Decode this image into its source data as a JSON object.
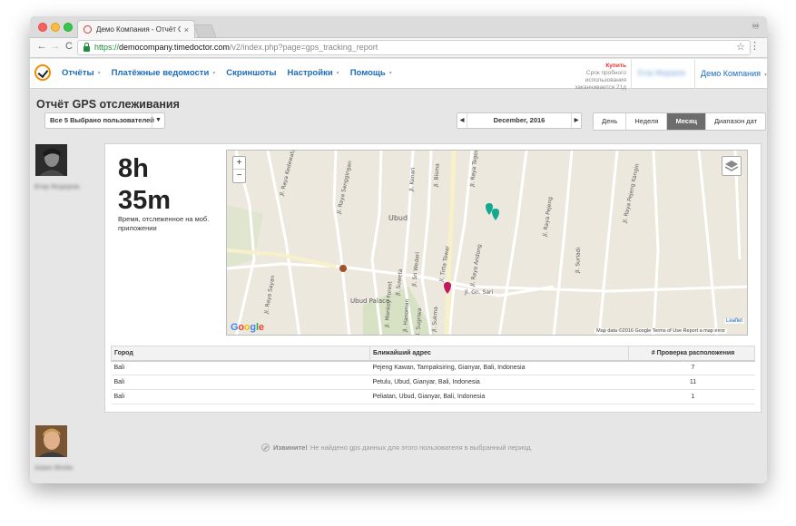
{
  "browser": {
    "tab_title": "Демо Компания - Отчёт GPS",
    "tab_close": "×",
    "url_scheme": "https://",
    "url_host": "democompany.timedoctor.com",
    "url_path": "/v2/index.php?page=gps_tracking_report",
    "back": "←",
    "forward": "→",
    "reload": "C",
    "star": "☆",
    "menu": "⋮",
    "incognito": "♾"
  },
  "header": {
    "menu": [
      {
        "label": "Отчёты"
      },
      {
        "label": "Платёжные ведомости"
      },
      {
        "label": "Скриншоты"
      },
      {
        "label": "Настройки"
      },
      {
        "label": "Помощь"
      }
    ],
    "caret": "▾",
    "trial_buy": "Купить",
    "trial_line1": "Срок пробного",
    "trial_line2": "использования",
    "trial_line3": "заканчивается 21д",
    "user_name": "Егор Федоров",
    "company": "Демо Компания"
  },
  "report": {
    "title": "Отчёт GPS отслеживания",
    "user_select": "Все 5 Выбрано пользователей",
    "month": "December, 2016",
    "ranges": [
      "День",
      "Неделя",
      "Месяц",
      "Диапазон дат"
    ],
    "active_range": "Месяц"
  },
  "user1": {
    "name": "Егор Федоров",
    "hours": "8h",
    "minutes": "35m",
    "note": "Время, отслеженное на моб. приложении",
    "map": {
      "labels": [
        "Ubud",
        "Ubud Palace",
        "Jl. Raya Sanggingan",
        "Jl. Raya Sayan",
        "Jl. Suweta",
        "Jl. Sri Wedari",
        "Jl. Tirta Tawar",
        "Jl. Raya Andong",
        "Jl. Raya Pejeng",
        "Jl. Monkey Forest",
        "Jl. Hanoman",
        "Jl. Sugriwa",
        "Jl. Gn. Sari",
        "Jl. Sukma",
        "Jl. Kenari",
        "Jl. Raya Teges",
        "Jl. Suriadi",
        "Jl. Raya Pejeng Kangin",
        "Jl. Bisma",
        "Jl. Raya Kedewatan"
      ],
      "zoom_in": "+",
      "zoom_out": "−",
      "google": [
        "G",
        "o",
        "o",
        "g",
        "l",
        "e"
      ],
      "attribution": "Map data ©2016 Google   Terms of Use   Report a map error",
      "leaflet": "Leaflet"
    },
    "table": {
      "headers": [
        "Город",
        "Ближайший адрес",
        "# Проверка расположения"
      ],
      "rows": [
        [
          "Bali",
          "Pejeng Kawan, Tampaksiring, Gianyar, Bali, Indonesia",
          "7"
        ],
        [
          "Bali",
          "Petulu, Ubud, Gianyar, Bali, Indonesia",
          "11"
        ],
        [
          "Bali",
          "Peliatan, Ubud, Gianyar, Bali, Indonesia",
          "1"
        ]
      ]
    }
  },
  "user2": {
    "name": "Adam Wintle",
    "sorry_bold": "Извините!",
    "sorry_text": "Не найдено gps данных для этого пользователя в выбранный период."
  },
  "colors": {
    "accent": "#1a6bc0",
    "buy": "#e5322d",
    "active_range": "#6d6d6d",
    "marker_teal": "#14a98e",
    "marker_pink": "#c2185b"
  }
}
